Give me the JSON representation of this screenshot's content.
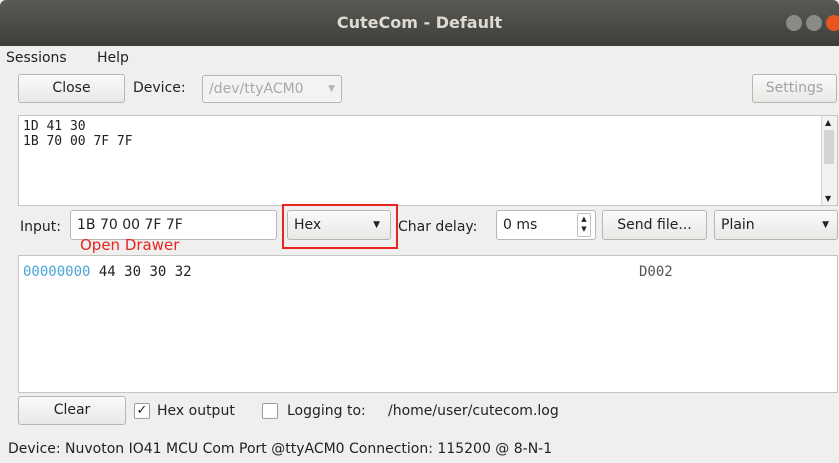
{
  "window": {
    "title": "CuteCom - Default"
  },
  "menu": {
    "sessions": "Sessions",
    "help": "Help"
  },
  "toolbar": {
    "close_label": "Close",
    "device_label": "Device:",
    "device_value": "/dev/ttyACM0",
    "settings_label": "Settings"
  },
  "top_log": {
    "lines": [
      "1D 41 30",
      "1B 70 00 7F 7F"
    ]
  },
  "input_row": {
    "input_label": "Input:",
    "input_value": "1B 70 00 7F 7F",
    "format_value": "Hex",
    "char_delay_label": "Char delay:",
    "char_delay_value": "0 ms",
    "send_file_label": "Send file...",
    "mode_value": "Plain"
  },
  "annotation": {
    "text": "Open Drawer",
    "color": "#e8251e"
  },
  "output": {
    "offset": "00000000",
    "bytes": "44 30 30 32",
    "ascii": "D002",
    "offset_color": "#4aa3d8"
  },
  "bottom": {
    "clear_label": "Clear",
    "hex_output_label": "Hex output",
    "hex_output_checked": true,
    "logging_label": "Logging to:",
    "logging_checked": false,
    "log_path": "/home/user/cutecom.log"
  },
  "status": {
    "text": "Device: Nuvoton IO41 MCU Com Port @ttyACM0  Connection: 115200 @ 8-N-1"
  }
}
